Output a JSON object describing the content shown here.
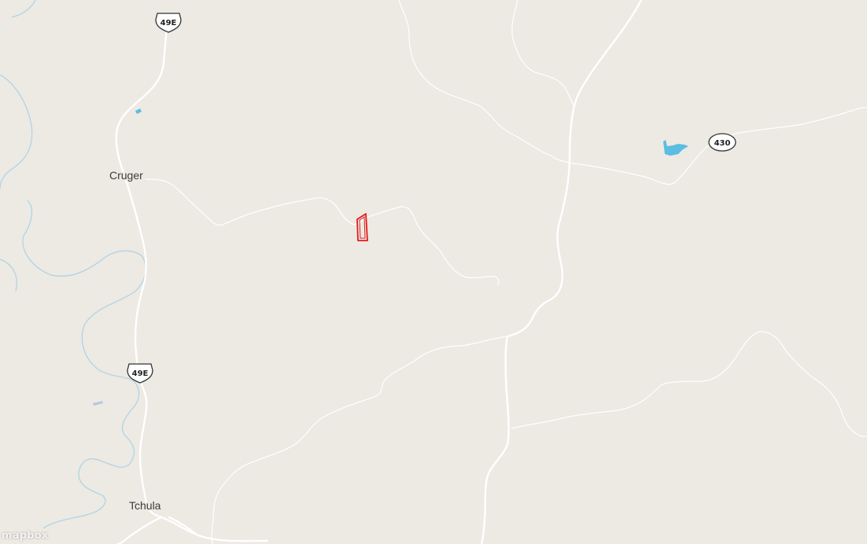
{
  "map": {
    "colors": {
      "land": "#ede9e3",
      "water_line": "#a9d4e6",
      "water_fill": "#5bbde2",
      "road": "#ffffff",
      "highlight": "#e31a1c"
    },
    "places": {
      "cruger": "Cruger",
      "tchula": "Tchula"
    },
    "shields": {
      "us49e_north": "49E",
      "us49e_south": "49E",
      "ms430": "430"
    },
    "attribution": "mapbox"
  }
}
